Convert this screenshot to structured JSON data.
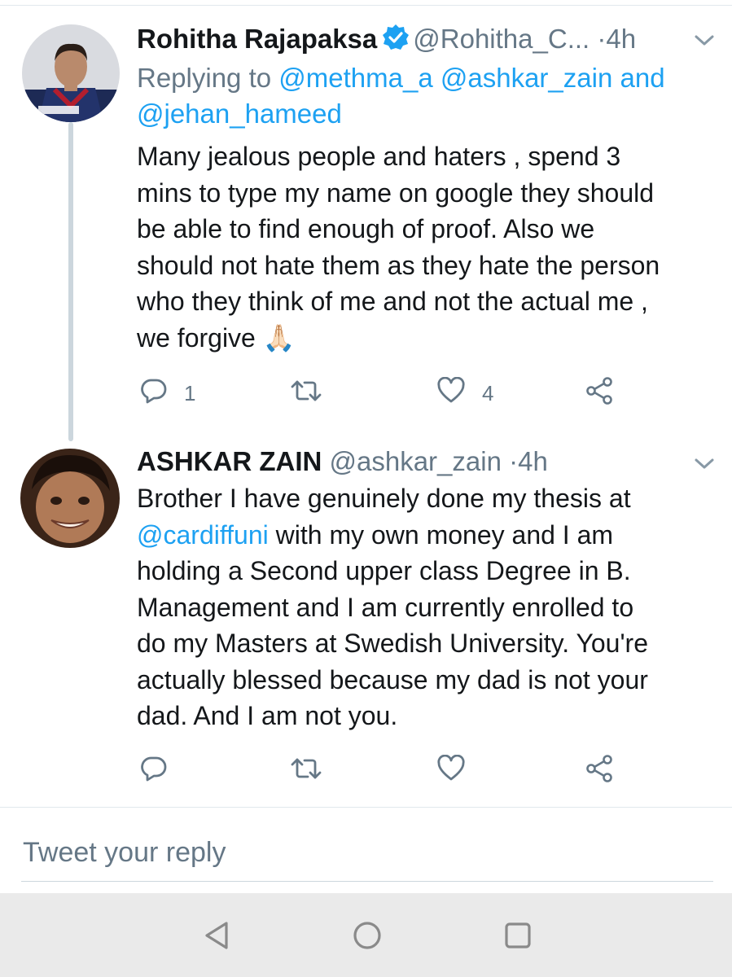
{
  "tweets": [
    {
      "name": "Rohitha Rajapaksa",
      "verified": true,
      "handle": "@Rohitha_C...",
      "sep": "·",
      "time": "4h",
      "replying_prefix": "Replying to",
      "replying_mentions_line1": "@methma_a @ashkar_zain",
      "replying_and": "and",
      "replying_mentions_line2": "@jehan_hameed",
      "body_lines": [
        "Many jealous people and haters , spend 3",
        "mins to type my name on google they should",
        "be able to find enough of proof. Also we",
        "should not hate them as they hate the person",
        "who they think of me and not the actual me ,",
        "we forgive 🙏🏻"
      ],
      "reply_count": "1",
      "retweet_count": "",
      "like_count": "4"
    },
    {
      "name": "ASHKAR ZAIN",
      "verified": false,
      "handle": "@ashkar_zain",
      "sep": "·",
      "time": "4h",
      "body_line1": "Brother I have genuinely done my thesis at",
      "body_mention": "@cardiffuni",
      "body_line2_rest": " with my own money and I am",
      "body_lines_rest": [
        "holding a Second upper class Degree in B.",
        "Management and I am currently enrolled to",
        "do my Masters at Swedish University. You're",
        "actually blessed because my dad is not your",
        "dad. And I am not you."
      ],
      "reply_count": "",
      "retweet_count": "",
      "like_count": ""
    }
  ],
  "reply_box": {
    "placeholder": "Tweet your reply"
  },
  "icons": {
    "reply": "reply-icon",
    "retweet": "retweet-icon",
    "like": "heart-icon",
    "share": "share-icon",
    "more": "chevron-down-icon",
    "verified": "verified-badge-icon",
    "nav_back": "triangle-back-icon",
    "nav_home": "circle-home-icon",
    "nav_recents": "square-recents-icon"
  },
  "colors": {
    "link": "#1da1f2",
    "secondary_text": "#657786",
    "primary_text": "#14171a",
    "navbar_bg": "#eaeaea"
  }
}
